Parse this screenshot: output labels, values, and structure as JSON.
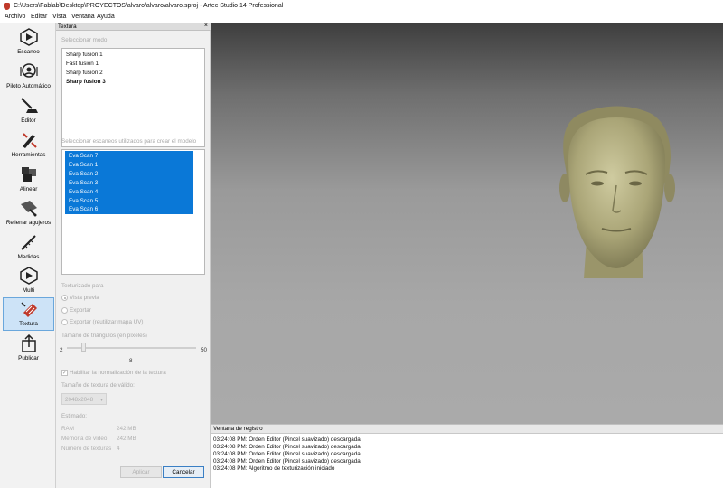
{
  "window": {
    "title": "C:\\Users\\Fablab\\Desktop\\PROYECTOS\\alvaro\\alvaro\\alvaro.sproj - Artec Studio 14 Professional"
  },
  "menu": [
    "Archivo",
    "Editar",
    "Vista",
    "Ventana",
    "Ayuda"
  ],
  "toolbar": [
    {
      "label": "Escaneo",
      "icon": "scan-play-icon"
    },
    {
      "label": "Piloto Automático",
      "icon": "autopilot-icon"
    },
    {
      "label": "Editor",
      "icon": "eraser-editor-icon"
    },
    {
      "label": "Herramientas",
      "icon": "tools-icon"
    },
    {
      "label": "Alinear",
      "icon": "align-icon"
    },
    {
      "label": "Rellenar agujeros",
      "icon": "fill-holes-icon"
    },
    {
      "label": "Medidas",
      "icon": "measure-icon"
    },
    {
      "label": "Multi",
      "icon": "multi-icon"
    },
    {
      "label": "Textura",
      "icon": "texture-icon",
      "active": true
    },
    {
      "label": "Publicar",
      "icon": "publish-icon"
    }
  ],
  "panel": {
    "title": "Textura",
    "close": "×",
    "mode_label": "Seleccionar modo",
    "modes": [
      "Sharp fusion 1",
      "Fast fusion 1",
      "Sharp fusion 2",
      "Sharp fusion 3"
    ],
    "scans_label": "Seleccionar escaneos utilizados para crear el modelo",
    "scans": [
      "Eva Scan 7",
      "Eva Scan 1",
      "Eva Scan 2",
      "Eva Scan 3",
      "Eva Scan 4",
      "Eva Scan 5",
      "Eva Scan 6"
    ],
    "texturize_label": "Texturizado para",
    "options": [
      "Vista previa",
      "Exportar",
      "Exportar (reutilizar mapa UV)"
    ],
    "triangle_label": "Tamaño de triángulos (en píxeles)",
    "slider": {
      "min": "2",
      "max": "50",
      "value": "8"
    },
    "normalize_label": "Habilitar la normalización de la textura",
    "texture_size_label": "Tamaño de textura de válido:",
    "texture_size": "2048x2048",
    "estimated_label": "Estimado:",
    "estimates": [
      {
        "name": "RAM",
        "value": "242 MB"
      },
      {
        "name": "Memoria de vídeo",
        "value": "242 MB"
      },
      {
        "name": "Número de texturas",
        "value": "4"
      }
    ],
    "apply": "Aplicar",
    "cancel": "Cancelar"
  },
  "log": {
    "title": "Ventana de registro",
    "lines": [
      "03:24:08 PM: Orden Editor (Pincel suavizado) descargada",
      "03:24:08 PM: Orden Editor (Pincel suavizado) descargada",
      "03:24:08 PM: Orden Editor (Pincel suavizado) descargada",
      "03:24:08 PM: Orden Editor (Pincel suavizado) descargada",
      "03:24:08 PM: Algoritmo de texturización iniciado"
    ]
  },
  "colors": {
    "selection": "#0a78d7",
    "active_tool": "#cde3f7",
    "head": "#b4b083"
  }
}
